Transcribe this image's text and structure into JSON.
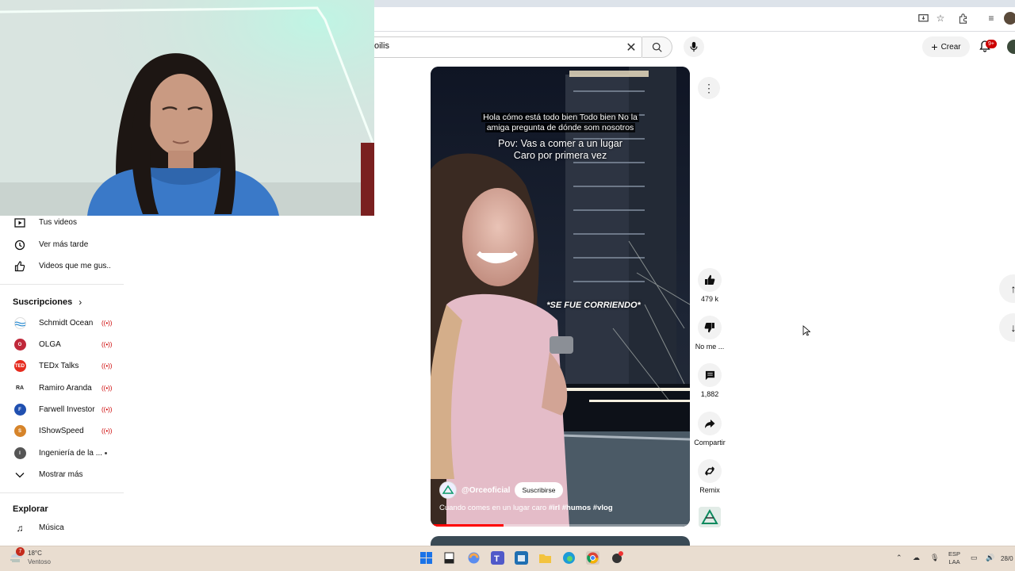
{
  "search": {
    "query": "oilis"
  },
  "header": {
    "create_label": "Crear",
    "notif_count": "9+"
  },
  "sidebar": {
    "you_items": [
      {
        "label": "Tus videos",
        "icon": "play-square-icon"
      },
      {
        "label": "Ver más tarde",
        "icon": "clock-icon"
      },
      {
        "label": "Videos que me gus...",
        "icon": "thumb-up-icon"
      }
    ],
    "subs_title": "Suscripciones",
    "subscriptions": [
      {
        "label": "Schmidt Ocean",
        "live": true,
        "color": "#1f7bbf"
      },
      {
        "label": "OLGA",
        "live": true,
        "color": "#c0283a"
      },
      {
        "label": "TEDx Talks",
        "live": true,
        "color": "#e62b1e"
      },
      {
        "label": "Ramiro Aranda",
        "live": true,
        "color": "#222222"
      },
      {
        "label": "Farwell Investor",
        "live": true,
        "color": "#2050b0"
      },
      {
        "label": "IShowSpeed",
        "live": true,
        "color": "#d6842a"
      },
      {
        "label": "Ingeniería de la ...",
        "live": false,
        "color": "#555555"
      }
    ],
    "show_more": "Mostrar más",
    "explore_title": "Explorar",
    "explore_items": [
      {
        "label": "Música",
        "icon": "music-note-icon"
      }
    ]
  },
  "video": {
    "subtitle_line1": "Hola cómo está todo bien Todo bien No la",
    "subtitle_line2": "amiga pregunta de dónde som nosotros",
    "pov_line1": "Pov: Vas a comer a un lugar",
    "pov_line2": "Caro por primera vez",
    "effect_text": "*SE FUE CORRIENDO*",
    "channel": "@Orceoficial",
    "subscribe_label": "Suscribirse",
    "description": "Cuando comes en un lugar caro",
    "hashtags": "#irl #humos #vlog",
    "progress": 0.28
  },
  "actions": {
    "likes": "479 k",
    "dislike_label": "No me ...",
    "comments": "1,882",
    "share_label": "Compartir",
    "remix_label": "Remix"
  },
  "taskbar": {
    "weather_badge": "7",
    "temperature": "18°C",
    "condition": "Ventoso",
    "lang_line1": "ESP",
    "lang_line2": "LAA",
    "date": "28/0"
  }
}
